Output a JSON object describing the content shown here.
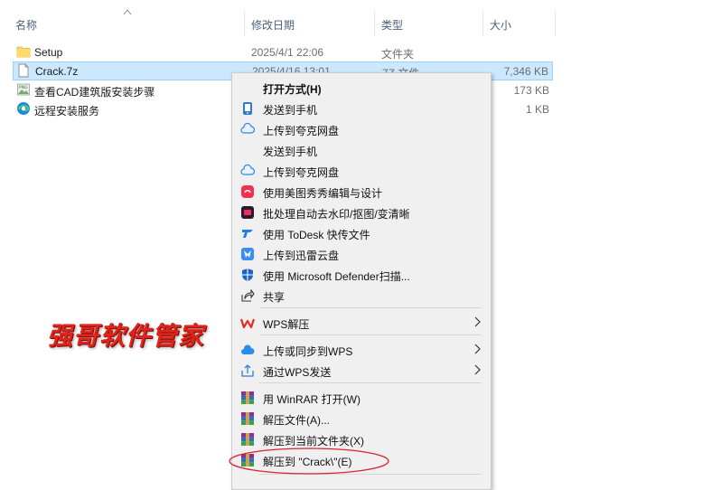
{
  "columns": {
    "name": "名称",
    "date": "修改日期",
    "type": "类型",
    "size": "大小"
  },
  "files": [
    {
      "name": "Setup",
      "date": "2025/4/1 22:06",
      "type": "文件夹",
      "size": "",
      "icon": "folder-icon"
    },
    {
      "name": "Crack.7z",
      "date": "2025/4/16 13:01",
      "type": "7Z 文件",
      "size": "7,346 KB",
      "icon": "file-icon",
      "selected": true
    },
    {
      "name": "查看CAD建筑版安装步骤",
      "date": "",
      "type": "",
      "size": "173 KB",
      "icon": "png-icon"
    },
    {
      "name": "远程安装服务",
      "date": "",
      "type": "",
      "size": "1 KB",
      "icon": "edge-icon"
    }
  ],
  "menu": {
    "items": [
      {
        "label": "打开方式(H)",
        "icon": "none",
        "bold": true
      },
      {
        "label": "发送到手机",
        "icon": "phone-send-icon"
      },
      {
        "label": "上传到夸克网盘",
        "icon": "quark-cloud-icon"
      },
      {
        "label": "发送到手机",
        "icon": "none"
      },
      {
        "label": "上传到夸克网盘",
        "icon": "quark-cloud-icon"
      },
      {
        "label": "使用美图秀秀编辑与设计",
        "icon": "meitu-icon"
      },
      {
        "label": "批处理自动去水印/抠图/变清晰",
        "icon": "batch-photo-icon"
      },
      {
        "label": "使用 ToDesk 快传文件",
        "icon": "todesk-icon"
      },
      {
        "label": "上传到迅雷云盘",
        "icon": "thunder-icon"
      },
      {
        "label": "使用 Microsoft Defender扫描...",
        "icon": "defender-icon"
      },
      {
        "label": "共享",
        "icon": "share-icon"
      },
      {
        "label": "WPS解压",
        "icon": "wps-icon",
        "submenu": true
      },
      {
        "label": "上传或同步到WPS",
        "icon": "wps-cloud-icon",
        "submenu": true
      },
      {
        "label": "通过WPS发送",
        "icon": "wps-send-icon",
        "submenu": true
      },
      {
        "label": "用 WinRAR 打开(W)",
        "icon": "winrar-icon"
      },
      {
        "label": "解压文件(A)...",
        "icon": "winrar-icon"
      },
      {
        "label": "解压到当前文件夹(X)",
        "icon": "winrar-icon"
      },
      {
        "label": "解压到 \"Crack\\\"(E)",
        "icon": "winrar-icon"
      }
    ]
  },
  "watermark": "强哥软件管家",
  "colors": {
    "selection_bg": "#cce8ff",
    "menu_bg": "#f0f0f0",
    "watermark": "#e0241b",
    "highlight_ellipse": "#d9232d"
  }
}
